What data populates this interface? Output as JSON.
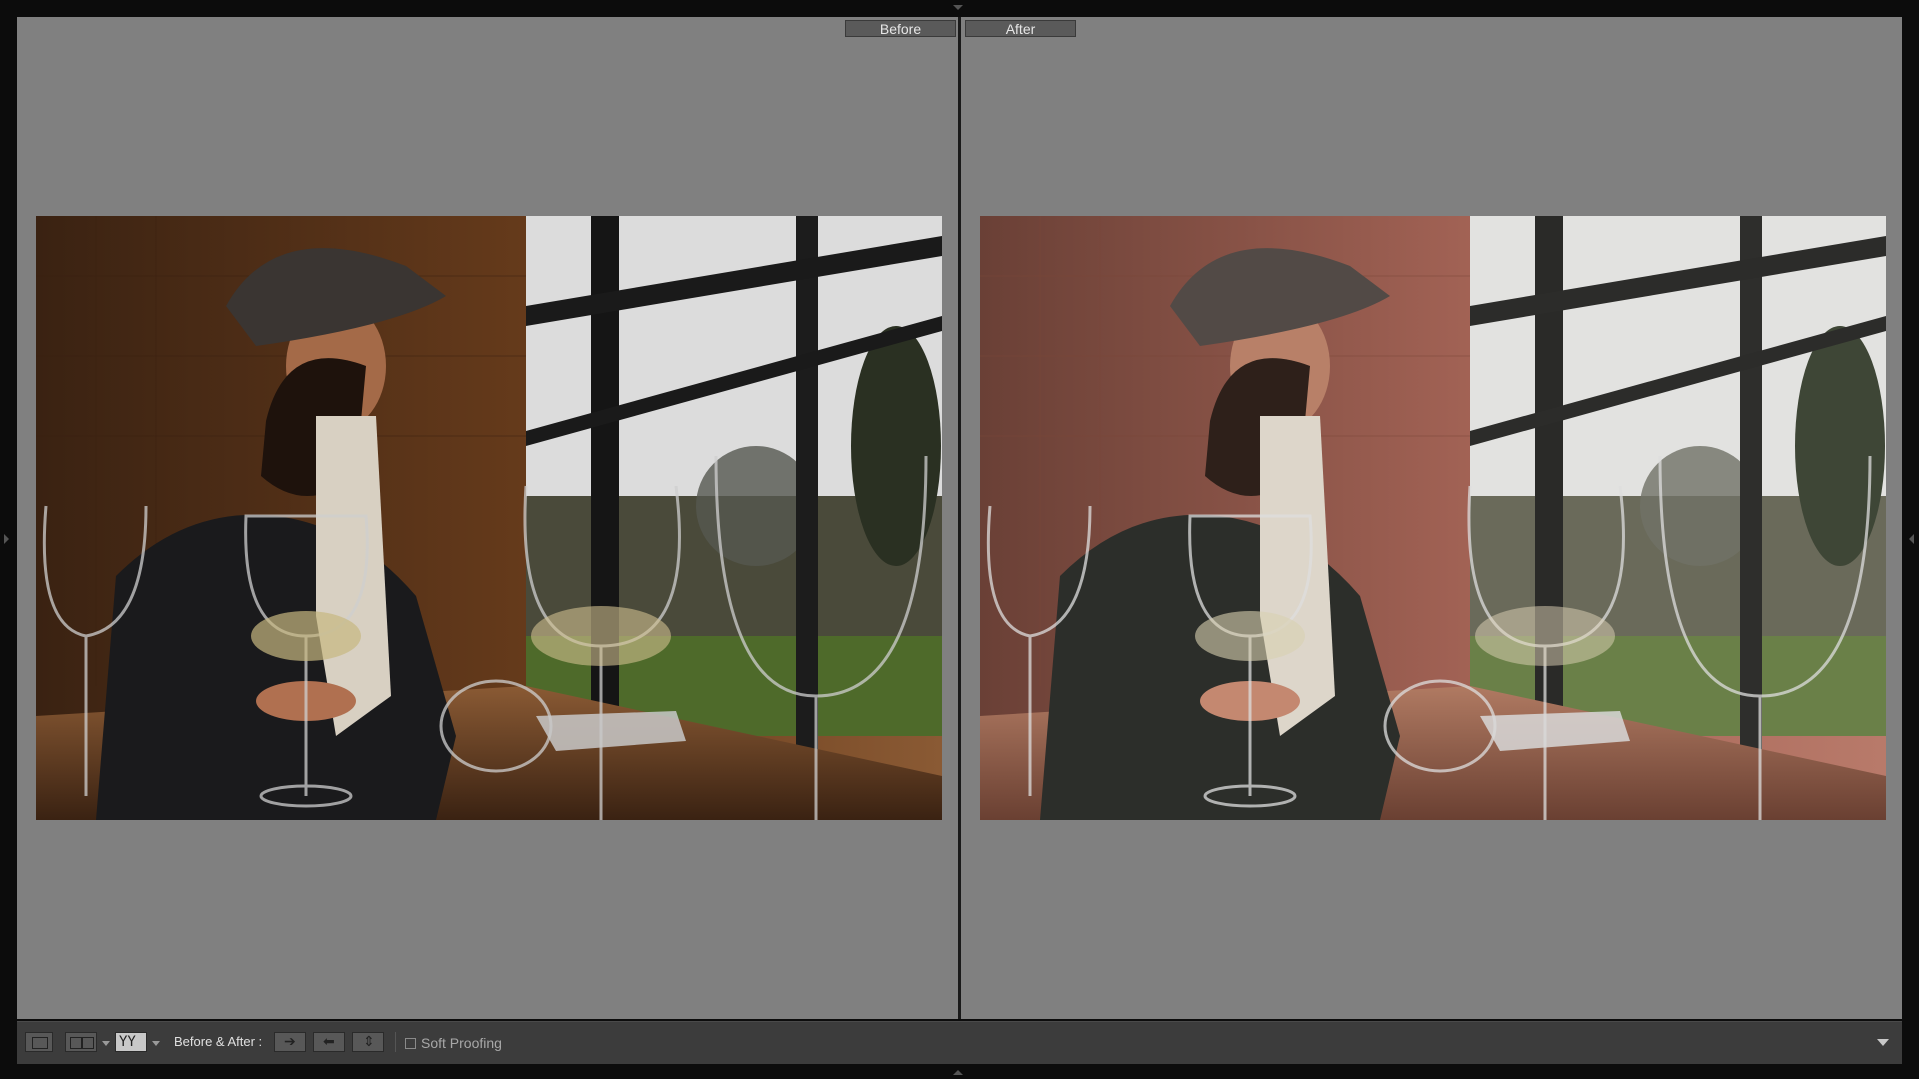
{
  "compare": {
    "before_label": "Before",
    "after_label": "After"
  },
  "toolbar": {
    "before_after_label": "Before & After :",
    "soft_proofing_label": "Soft Proofing",
    "icons": [
      "loupe-view-icon",
      "compare-view-icon",
      "before-after-view-icon",
      "copy-before-to-after-icon",
      "copy-after-to-before-icon",
      "swap-before-after-icon"
    ]
  },
  "colors": {
    "background": "#808080",
    "frame": "#0c0c0c",
    "toolbar": "#3c3c3c"
  }
}
